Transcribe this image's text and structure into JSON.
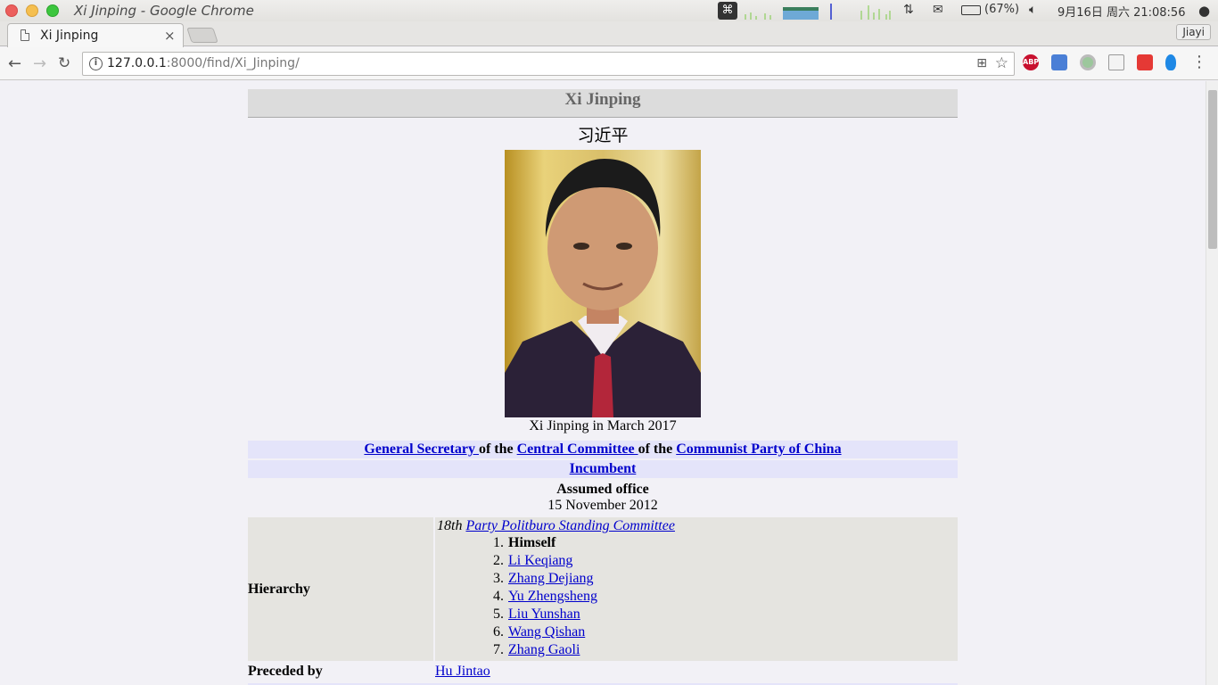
{
  "os_bar": {
    "window_title": "Xi Jinping - Google Chrome",
    "battery": "(67%)",
    "clock": "9月16日 周六 21:08:56"
  },
  "browser": {
    "tab_title": "Xi Jinping",
    "tab_close": "×",
    "profile_name": "Jiayi",
    "url_host": "127.0.0.1",
    "url_path": ":8000/find/Xi_Jinping/",
    "extensions": [
      "ABP"
    ]
  },
  "infobox": {
    "title": "Xi Jinping",
    "native_name": "习近平",
    "image_caption": "Xi Jinping in March 2017",
    "office": {
      "part1": "General Secretary ",
      "part2": "of the ",
      "part3": "Central Committee ",
      "part4": "of the ",
      "part5": "Communist Party of China"
    },
    "incumbent": "Incumbent",
    "assumed_office_label": "Assumed office",
    "assumed_office_date": "15 November 2012",
    "hierarchy": {
      "label": "Hierarchy",
      "committee_prefix": "18th",
      "committee_link": "Party Politburo Standing Committee",
      "members": [
        {
          "num": "1.",
          "name": "Himself"
        },
        {
          "num": "2.",
          "name": "Li Keqiang"
        },
        {
          "num": "3.",
          "name": "Zhang Dejiang"
        },
        {
          "num": "4.",
          "name": "Yu Zhengsheng"
        },
        {
          "num": "5.",
          "name": "Liu Yunshan"
        },
        {
          "num": "6.",
          "name": "Wang Qishan"
        },
        {
          "num": "7.",
          "name": "Zhang Gaoli"
        }
      ]
    },
    "preceded_by_label": "Preceded by",
    "preceded_by_value": "Hu Jintao"
  }
}
